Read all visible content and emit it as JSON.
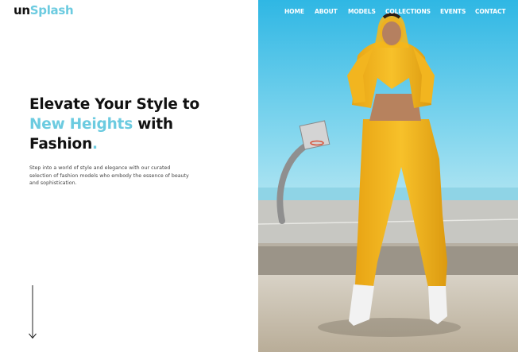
{
  "brand": {
    "prefix": "un",
    "suffix": "Splash"
  },
  "nav": {
    "home": "HOME",
    "about": "ABOUT",
    "models": "MODELS",
    "collections": "COLLECTIONS",
    "events": "EVENTS",
    "contact": "CONTACT"
  },
  "hero": {
    "line1": "Elevate Your Style to",
    "accent": "New Heights",
    "line2_rest": " with",
    "line3": "Fashion",
    "dot": ".",
    "description": "Step into a world of style and elegance with our curated selection of fashion models who embody the essence of beauty and sophistication."
  },
  "icons": {
    "scroll": "arrow-down-icon"
  },
  "colors": {
    "accent": "#6ccbe0",
    "text": "#111111",
    "outfit": "#f4b71c"
  }
}
